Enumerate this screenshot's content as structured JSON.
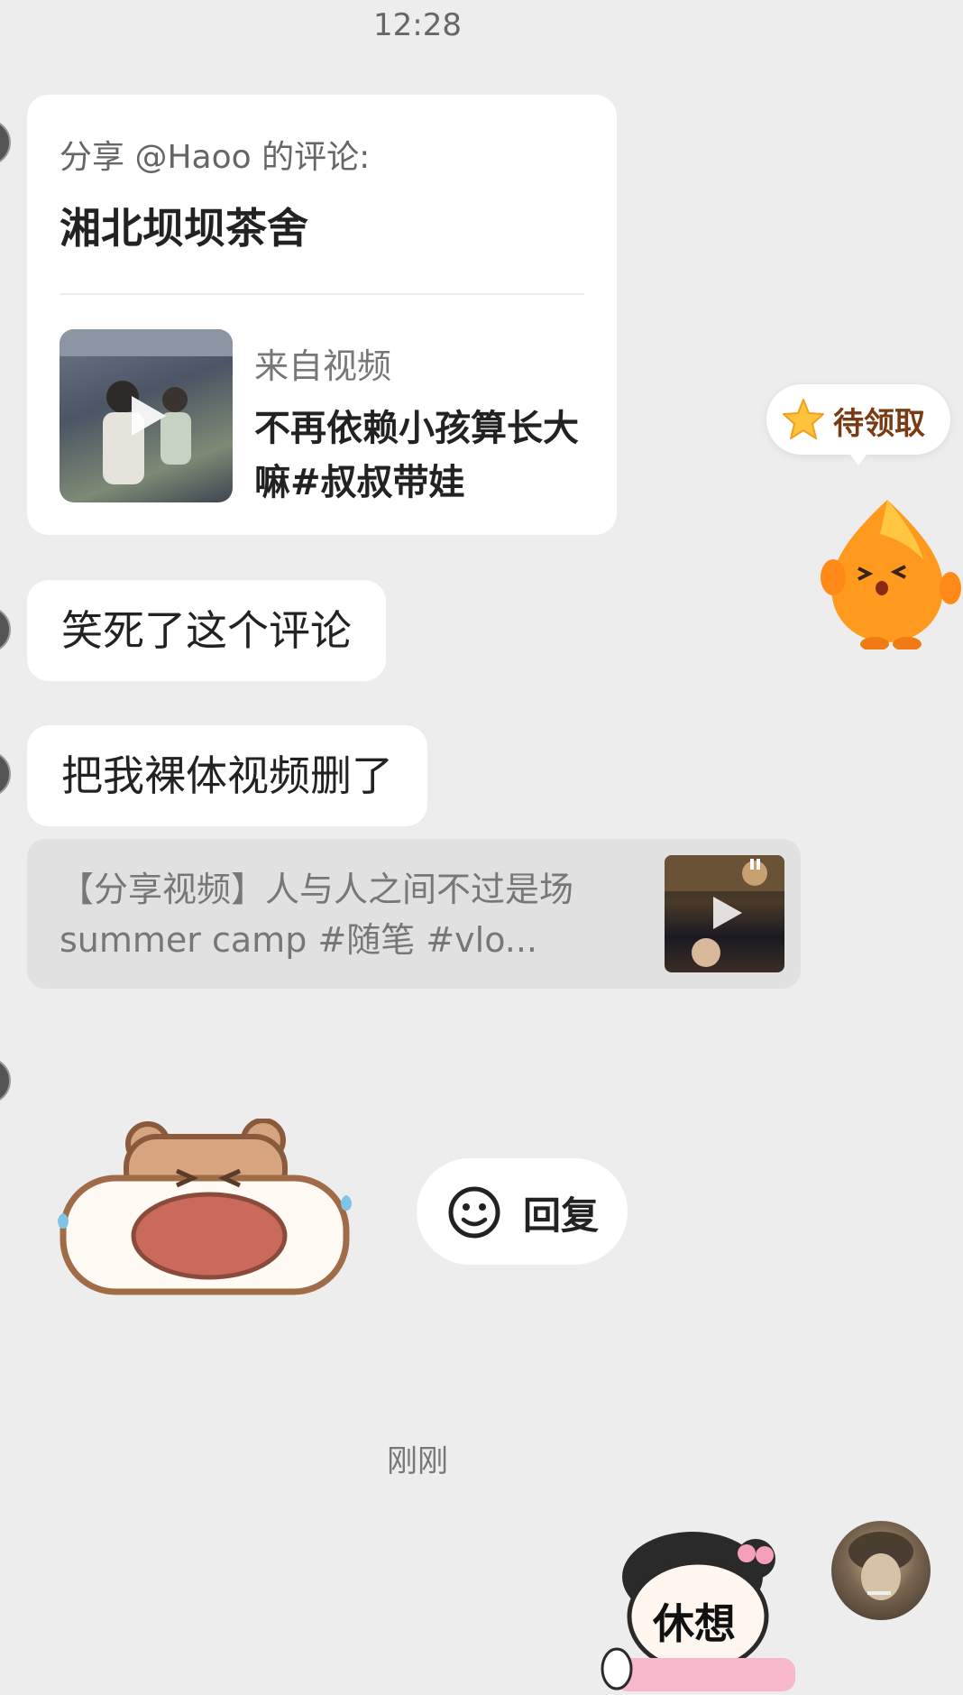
{
  "status": {
    "time": "12:28"
  },
  "share_card": {
    "title": "分享 @Haoo 的评论:",
    "comment": "湘北坝坝茶舍",
    "source_label": "来自视频",
    "video_title": "不再依赖小孩算长大嘛#叔叔带娃"
  },
  "messages": [
    {
      "text": "笑死了这个评论"
    },
    {
      "text": "把我裸体视频删了"
    }
  ],
  "link_card": {
    "text": "【分享视频】人与人之间不过是场 summer camp #随笔 #vlo..."
  },
  "sticker_bear": {
    "name": "crying-bear-sticker"
  },
  "reply_button": {
    "label": "回复",
    "icon": "smiley-face-icon"
  },
  "divider_time": "刚刚",
  "floating_widget": {
    "label": "待领取",
    "icon": "star-icon"
  },
  "sent_sticker": {
    "text": "休想"
  },
  "colors": {
    "background": "#ededed",
    "bubble": "#ffffff",
    "link_card": "#e1e1e1",
    "accent_orange": "#ff8a1a"
  }
}
